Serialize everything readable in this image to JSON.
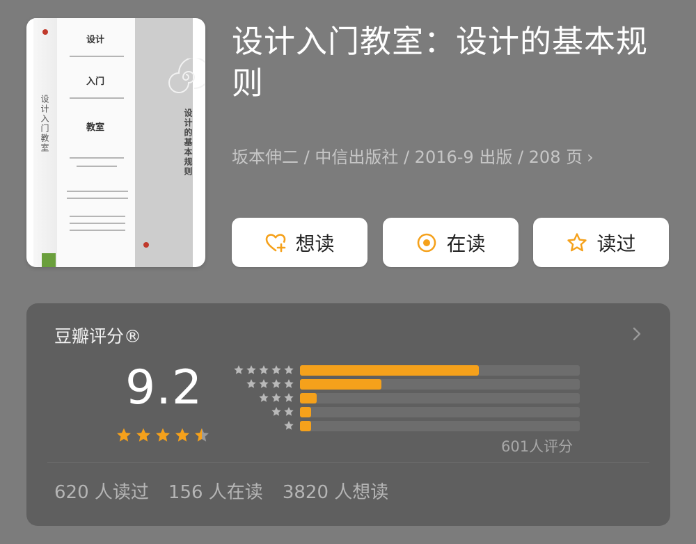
{
  "book": {
    "title": "设计入门教室：设计的基本规则",
    "meta": "坂本伸二 / 中信出版社 / 2016-9 出版 / 208 页",
    "cover": {
      "main_title_1": "设计",
      "main_title_2": "入门",
      "main_title_3": "教室",
      "subtitle_vertical": "设计的基本规则",
      "spine_text": "设计入门教室"
    }
  },
  "actions": {
    "want_label": "想读",
    "reading_label": "在读",
    "read_label": "读过"
  },
  "rating": {
    "title": "豆瓣评分®",
    "score": "9.2",
    "stars_out_of_5": 4.5,
    "distribution_fraction": [
      0.64,
      0.29,
      0.06,
      0.04,
      0.04
    ],
    "count_label": "601人评分"
  },
  "stats": {
    "read": "620 人读过",
    "reading": "156 人在读",
    "want": "3820 人想读"
  },
  "colors": {
    "accent": "#f5a11b",
    "background": "#7c7c7c",
    "card": "#5f5f5f"
  },
  "icons": {
    "want": "heart-plus-icon",
    "reading": "target-icon",
    "read": "star-outline-icon",
    "chevron": "chevron-right-icon"
  }
}
